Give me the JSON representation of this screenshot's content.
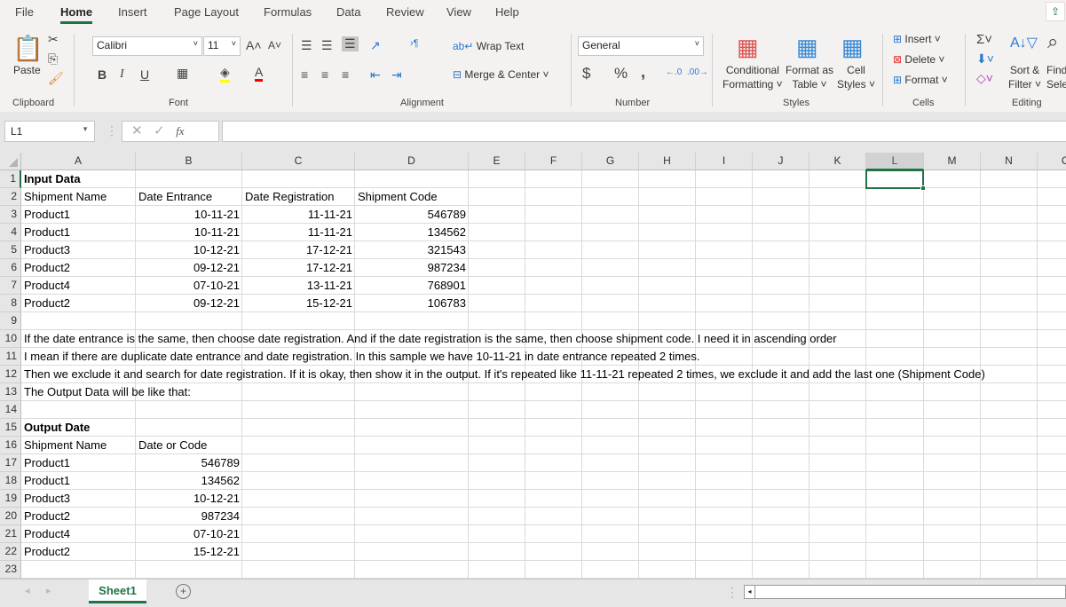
{
  "ribbon": {
    "tabs": [
      "File",
      "Home",
      "Insert",
      "Page Layout",
      "Formulas",
      "Data",
      "Review",
      "View",
      "Help"
    ],
    "active_tab": "Home",
    "clipboard": {
      "paste": "Paste",
      "group": "Clipboard"
    },
    "font": {
      "name": "Calibri",
      "size": "11",
      "group": "Font",
      "bold": "B",
      "italic": "I",
      "underline": "U"
    },
    "alignment": {
      "wrap_text": "Wrap Text",
      "merge_center": "Merge & Center",
      "group": "Alignment"
    },
    "number": {
      "format": "General",
      "currency": "$",
      "percent": "%",
      "comma": ",",
      "group": "Number"
    },
    "styles": {
      "conditional": [
        "Conditional",
        "Formatting ˅"
      ],
      "format_table": [
        "Format as",
        "Table ˅"
      ],
      "cell_styles": [
        "Cell",
        "Styles ˅"
      ],
      "group": "Styles"
    },
    "cells": {
      "insert": "Insert",
      "delete": "Delete",
      "format": "Format",
      "group": "Cells"
    },
    "editing": {
      "sort": [
        "Sort &",
        "Filter ˅"
      ],
      "find": [
        "Find",
        "Selec"
      ],
      "group": "Editing"
    }
  },
  "formula_bar": {
    "name_box": "L1",
    "fx": "fx",
    "value": ""
  },
  "sheet": {
    "columns": [
      "A",
      "B",
      "C",
      "D",
      "E",
      "F",
      "G",
      "H",
      "I",
      "J",
      "K",
      "L",
      "M",
      "N",
      "O"
    ],
    "selected_column": "L",
    "selected_cell": "L1",
    "row_count": 23,
    "rows": [
      {
        "n": 1,
        "cells": {
          "A": "Input Data"
        }
      },
      {
        "n": 2,
        "cells": {
          "A": "Shipment Name",
          "B": "Date Entrance",
          "C": "Date Registration",
          "D": "Shipment Code"
        }
      },
      {
        "n": 3,
        "cells": {
          "A": "Product1",
          "B": "10-11-21",
          "C": "11-11-21",
          "D": "546789"
        }
      },
      {
        "n": 4,
        "cells": {
          "A": "Product1",
          "B": "10-11-21",
          "C": "11-11-21",
          "D": "134562"
        }
      },
      {
        "n": 5,
        "cells": {
          "A": "Product3",
          "B": "10-12-21",
          "C": "17-12-21",
          "D": "321543"
        }
      },
      {
        "n": 6,
        "cells": {
          "A": "Product2",
          "B": "09-12-21",
          "C": "17-12-21",
          "D": "987234"
        }
      },
      {
        "n": 7,
        "cells": {
          "A": "Product4",
          "B": "07-10-21",
          "C": "13-11-21",
          "D": "768901"
        }
      },
      {
        "n": 8,
        "cells": {
          "A": "Product2",
          "B": "09-12-21",
          "C": "15-12-21",
          "D": "106783"
        }
      },
      {
        "n": 10,
        "cells": {
          "A": "If the date entrance is the same, then choose date registration. And if the date registration is the same, then choose shipment code. I need it in ascending order"
        }
      },
      {
        "n": 11,
        "cells": {
          "A": "I mean if there are duplicate date entrance and date registration. In this sample we have 10-11-21 in date entrance repeated 2 times."
        }
      },
      {
        "n": 12,
        "cells": {
          "A": "Then we exclude it and search for date registration. If it is okay, then show it in the output. If it's repeated like 11-11-21 repeated 2 times, we exclude it and add the last one (Shipment Code)"
        }
      },
      {
        "n": 13,
        "cells": {
          "A": "The Output Data will be like that:"
        }
      },
      {
        "n": 15,
        "cells": {
          "A": "Output Date"
        }
      },
      {
        "n": 16,
        "cells": {
          "A": "Shipment Name",
          "B": "Date or Code"
        }
      },
      {
        "n": 17,
        "cells": {
          "A": "Product1",
          "B": "546789"
        }
      },
      {
        "n": 18,
        "cells": {
          "A": "Product1",
          "B": "134562"
        }
      },
      {
        "n": 19,
        "cells": {
          "A": "Product3",
          "B": "10-12-21"
        }
      },
      {
        "n": 20,
        "cells": {
          "A": "Product2",
          "B": "987234"
        }
      },
      {
        "n": 21,
        "cells": {
          "A": "Product4",
          "B": "07-10-21"
        }
      },
      {
        "n": 22,
        "cells": {
          "A": "Product2",
          "B": "15-12-21"
        }
      }
    ]
  },
  "sheet_tabs": {
    "active": "Sheet1",
    "add": "+"
  },
  "colors": {
    "accent": "#217346"
  }
}
